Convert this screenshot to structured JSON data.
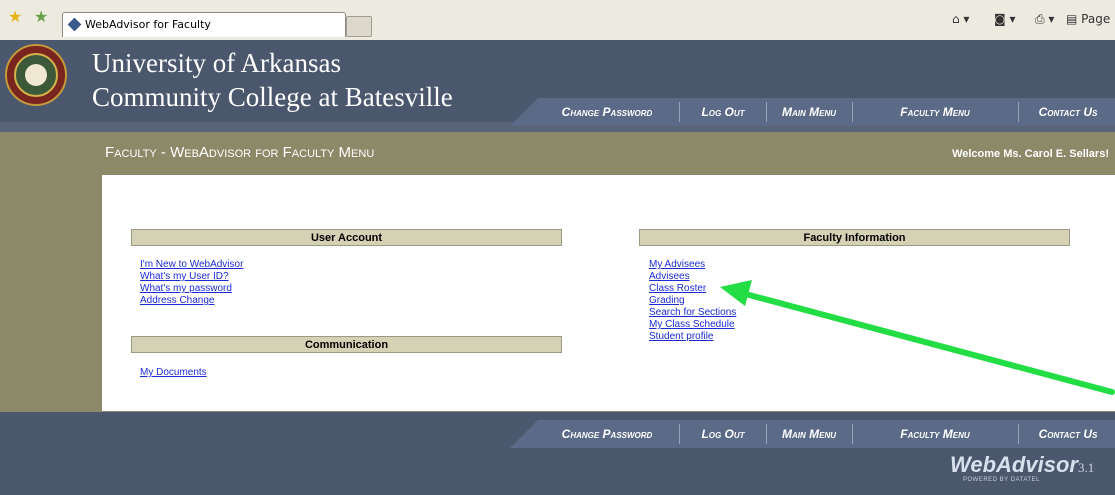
{
  "browser": {
    "tab_title": "WebAdvisor for Faculty",
    "page_button": "Page",
    "toolbar_icons": [
      "favorites-star-icon",
      "add-favorites-icon",
      "home-icon",
      "feeds-icon",
      "print-icon",
      "page-icon"
    ]
  },
  "header": {
    "college_line1": "University of Arkansas",
    "college_line2": "Community College at Batesville"
  },
  "nav": {
    "change_password": "Change Password",
    "log_out": "Log Out",
    "main_menu": "Main Menu",
    "faculty_menu": "Faculty Menu",
    "contact_us": "Contact Us"
  },
  "page": {
    "title": "Faculty - WebAdvisor for Faculty Menu",
    "welcome": "Welcome Ms. Carol E. Sellars!"
  },
  "user_account": {
    "heading": "User Account",
    "links": [
      "I'm New to WebAdvisor",
      "What's my User ID?",
      "What's my password",
      "Address Change"
    ]
  },
  "communication": {
    "heading": "Communication",
    "links": [
      "My Documents"
    ]
  },
  "faculty_info": {
    "heading": "Faculty Information",
    "links": [
      "My Advisees",
      "Advisees",
      "Class Roster",
      "Grading",
      "Search for Sections",
      "My Class Schedule",
      "Student profile"
    ]
  },
  "footer": {
    "logo_text": "WebAdvisor",
    "logo_version": "3.1",
    "powered": "POWERED BY DATATEL"
  },
  "annotation": {
    "arrow_color": "#22dd44"
  }
}
